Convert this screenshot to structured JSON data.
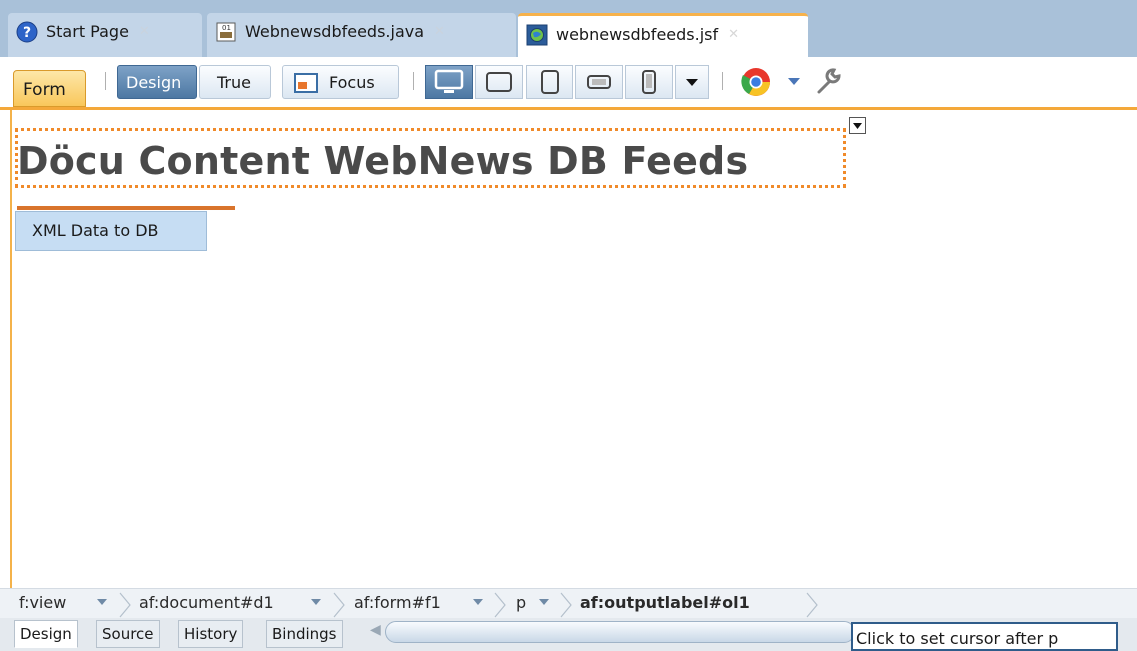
{
  "tabs": [
    {
      "label": "Start Page",
      "icon": "help-icon",
      "active": false
    },
    {
      "label": "Webnewsdbfeeds.java",
      "icon": "java-file-icon",
      "active": false
    },
    {
      "label": "webnewsdbfeeds.jsf",
      "icon": "jsf-globe-icon",
      "active": true
    }
  ],
  "toolbar": {
    "form_label": "Form",
    "design_label": "Design",
    "true_label": "True",
    "focus_label": "Focus",
    "devices": [
      "desktop-icon",
      "tablet-landscape-icon",
      "tablet-portrait-icon",
      "phone-landscape-icon",
      "phone-portrait-icon"
    ],
    "browser_icon": "chrome-icon",
    "settings_icon": "wrench-icon"
  },
  "canvas": {
    "heading": "Döcu Content WebNews DB Feeds",
    "button_label": "XML Data to DB"
  },
  "breadcrumb": [
    "f:view",
    "af:document#d1",
    "af:form#f1",
    "p",
    "af:outputlabel#ol1"
  ],
  "editor_tabs": [
    "Design",
    "Source",
    "History",
    "Bindings"
  ],
  "status": "Click to set cursor after p",
  "colors": {
    "accent_orange": "#f4a83a",
    "selection_dotted": "#f08a2a",
    "tab_bar": "#a9c1d9",
    "button_blue": "#c6ddf3"
  }
}
